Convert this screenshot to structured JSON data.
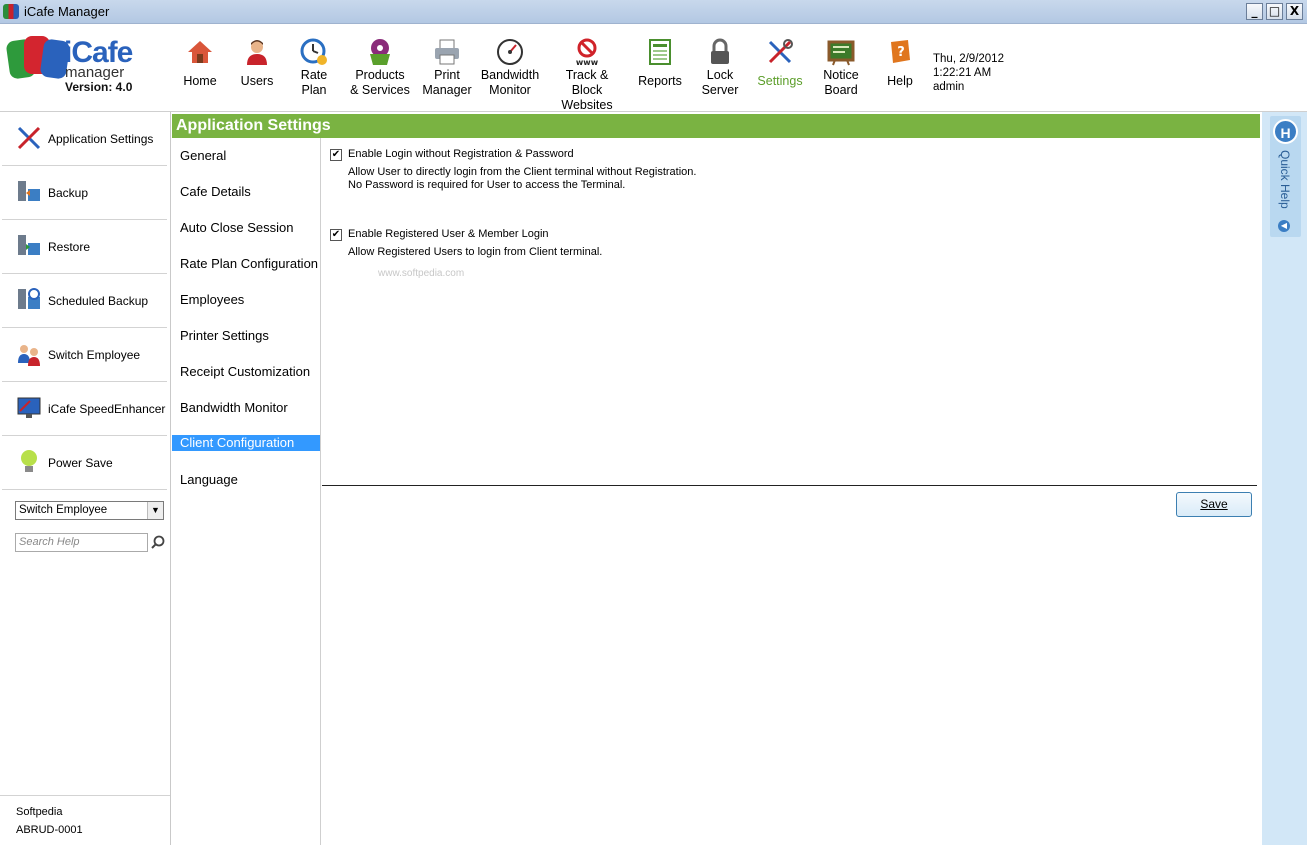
{
  "window": {
    "title": "iCafe Manager",
    "min_glyph": "_",
    "max_glyph": "□",
    "close_glyph": "X"
  },
  "logo": {
    "brand": "iCafe",
    "sub": "manager",
    "version": "Version: 4.0"
  },
  "toolbar": [
    {
      "id": "home",
      "line1": "Home",
      "line2": ""
    },
    {
      "id": "users",
      "line1": "Users",
      "line2": ""
    },
    {
      "id": "rate-plan",
      "line1": "Rate",
      "line2": "Plan"
    },
    {
      "id": "products",
      "line1": "Products",
      "line2": "& Services"
    },
    {
      "id": "print",
      "line1": "Print",
      "line2": "Manager"
    },
    {
      "id": "bandwidth",
      "line1": "Bandwidth",
      "line2": "Monitor"
    },
    {
      "id": "track",
      "line1": "Track &",
      "line2": "Block Websites"
    },
    {
      "id": "reports",
      "line1": "Reports",
      "line2": ""
    },
    {
      "id": "lock",
      "line1": "Lock",
      "line2": "Server"
    },
    {
      "id": "settings",
      "line1": "Settings",
      "line2": ""
    },
    {
      "id": "notice",
      "line1": "Notice",
      "line2": "Board"
    },
    {
      "id": "help",
      "line1": "Help",
      "line2": ""
    }
  ],
  "datetime": {
    "date": "Thu, 2/9/2012",
    "time": "1:22:21 AM",
    "user": "admin"
  },
  "sidebar": {
    "items": [
      {
        "line1": "Application Settings",
        "line2": ""
      },
      {
        "line1": "Backup",
        "line2": ""
      },
      {
        "line1": "Restore",
        "line2": ""
      },
      {
        "line1": "Scheduled Backup",
        "line2": ""
      },
      {
        "line1": "Switch Employee",
        "line2": ""
      },
      {
        "line1": "iCafe Speed",
        "line2": "Enhancer"
      },
      {
        "line1": "Power Save",
        "line2": ""
      }
    ],
    "switch_select": "Switch Employee",
    "search_placeholder": "Search Help",
    "footer_name": "Softpedia",
    "footer_id": "ABRUD-0001"
  },
  "panel": {
    "title": "Application Settings",
    "nav": [
      "General",
      "Cafe Details",
      "Auto Close Session",
      "Rate Plan Configuration",
      "Employees",
      "Printer Settings",
      "Receipt Customization",
      "Bandwidth Monitor",
      "Client Configuration",
      "Language"
    ],
    "selected_nav": "Client Configuration",
    "options": [
      {
        "label": "Enable Login without Registration & Password",
        "checked": true,
        "desc1": "Allow User to directly login from the Client terminal without Registration.",
        "desc2": "No Password is required for User to access the Terminal."
      },
      {
        "label": "Enable Registered User & Member Login",
        "checked": true,
        "desc1": "Allow Registered Users to login from Client terminal.",
        "desc2": ""
      }
    ],
    "watermark": "www.softpedia.com",
    "save_label": "Save"
  },
  "quick_help": {
    "icon_letter": "H",
    "label": "Quick Help"
  }
}
